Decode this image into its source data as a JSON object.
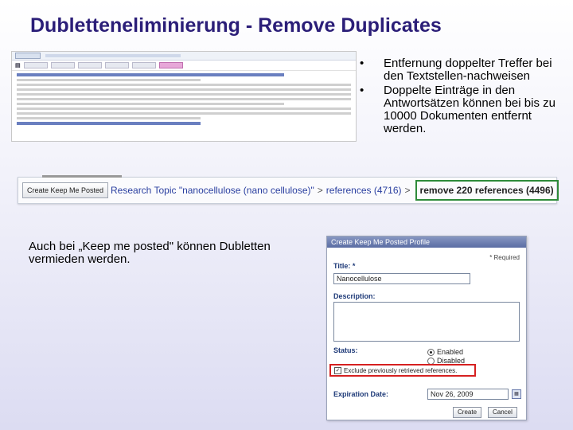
{
  "slide": {
    "title": "Dubletteneliminierung - Remove Duplicates"
  },
  "bullets": [
    "Entfernung doppelter Treffer bei den Textstellen-nachweisen",
    "Doppelte Einträge in den Antwortsätzen können bei bis zu 10000 Dokumenten entfernt werden."
  ],
  "bullet_glyph": "•",
  "breadcrumb": {
    "button_label": "Create Keep Me Posted",
    "topic": "Research Topic \"nanocellulose (nano cellulose)\"",
    "separator": ">",
    "references": "references (4716)",
    "remove": "remove 220 references (4496)"
  },
  "keep_text": "Auch bei „Keep me posted\" können Dubletten vermieden werden.",
  "dialog": {
    "title": "Create Keep Me Posted Profile",
    "required_note": "* Required",
    "title_label": "Title: *",
    "title_value": "Nanocellulose",
    "description_label": "Description:",
    "status_label": "Status:",
    "status_enabled": "Enabled",
    "status_disabled": "Disabled",
    "exclude_label": "Exclude previously retrieved references.",
    "expiration_label": "Expiration Date:",
    "expiration_value": "Nov 26, 2009",
    "create_button": "Create",
    "cancel_button": "Cancel"
  },
  "colors": {
    "title": "#2b1e78",
    "highlight_green": "#2e8b3a",
    "highlight_red": "#d62020"
  }
}
